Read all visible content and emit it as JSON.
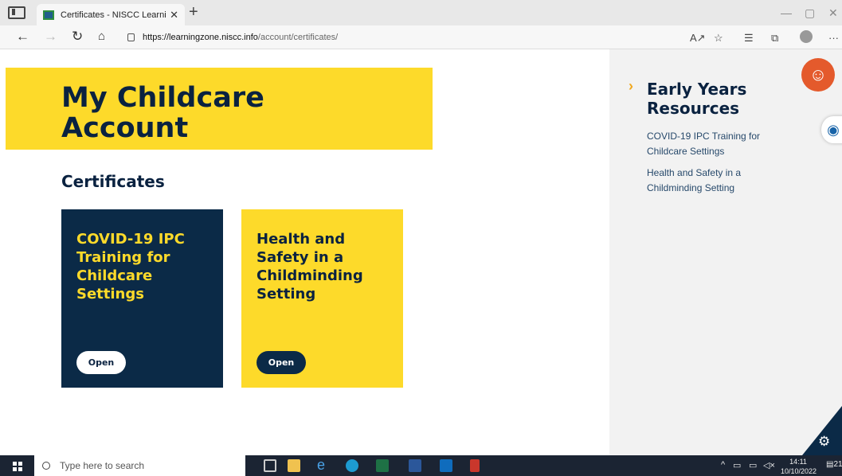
{
  "browser": {
    "tab_title": "Certificates - NISCC Learning Zo",
    "url_host": "https://learningzone.niscc.info",
    "url_path": "/account/certificates/"
  },
  "page": {
    "hero_title": "My Childcare Account",
    "section_title": "Certificates",
    "cards": [
      {
        "title": "COVID-19 IPC Training for Childcare Settings",
        "button": "Open"
      },
      {
        "title": "Health and Safety in a Childminding Setting",
        "button": "Open"
      }
    ]
  },
  "sidebar": {
    "title": "Early Years Resources",
    "links": [
      "COVID-19 IPC Training for Childcare Settings",
      "Health and Safety in a Childminding Setting"
    ]
  },
  "taskbar": {
    "search_placeholder": "Type here to search",
    "time": "14:11",
    "date": "10/10/2022",
    "notifications": "21"
  },
  "colors": {
    "brand_yellow": "#fdda2a",
    "brand_navy": "#0b2a47",
    "accessibility_orange": "#e45a2c"
  }
}
